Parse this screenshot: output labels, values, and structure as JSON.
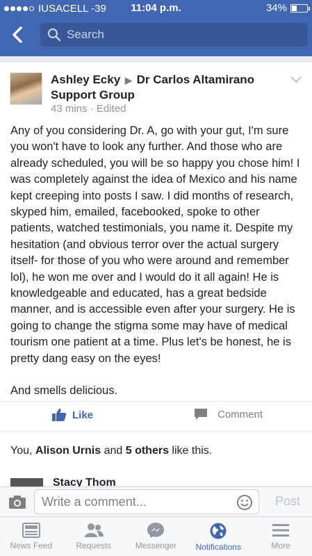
{
  "status_bar": {
    "carrier": "IUSACELL -39",
    "time": "11:04 p.m.",
    "battery": "34%",
    "battery_level": 0.34
  },
  "search": {
    "placeholder": "Search"
  },
  "post": {
    "author": "Ashley Ecky",
    "group": "Dr Carlos Altamirano Support Group",
    "time": "43 mins",
    "separator": "·",
    "edited": "Edited",
    "paragraph1": "Any of you considering Dr. A, go with your gut, I'm sure you won't have to look any further. And those who are already scheduled, you will be so happy you chose him! I was completely against the idea of Mexico and his name kept creeping into posts I saw. I did months of research, skyped him, emailed, facebooked, spoke to other patients, watched testimonials, you name it. Despite my hesitation (and obvious terror over the actual surgery itself- for those of you who were around and remember lol), he won me over and I would do it all again! He is knowledgeable and educated, has a great bedside manner, and is accessible even after your surgery. He is going to change the stigma some may have of medical tourism one patient at a time. Plus let's be honest, he is pretty dang easy on the eyes!",
    "paragraph2": "And smells delicious.",
    "like_label": "Like",
    "comment_label": "Comment",
    "likes": {
      "prefix": "You, ",
      "name": "Alison Urnis",
      "middle": " and ",
      "others": "5 others",
      "suffix": " like this."
    },
    "next_comment_author": "Stacy Thom"
  },
  "composer": {
    "placeholder": "Write a comment...",
    "post_label": "Post"
  },
  "tabs": [
    {
      "label": "News Feed",
      "icon": "news-feed-icon",
      "active": false
    },
    {
      "label": "Requests",
      "icon": "friend-requests-icon",
      "active": false
    },
    {
      "label": "Messenger",
      "icon": "messenger-icon",
      "active": false
    },
    {
      "label": "Notifications",
      "icon": "globe-icon",
      "active": true
    },
    {
      "label": "More",
      "icon": "menu-icon",
      "active": false
    }
  ],
  "colors": {
    "brand": "#4267b2",
    "header": "#4267b2",
    "muted": "#90949c"
  }
}
